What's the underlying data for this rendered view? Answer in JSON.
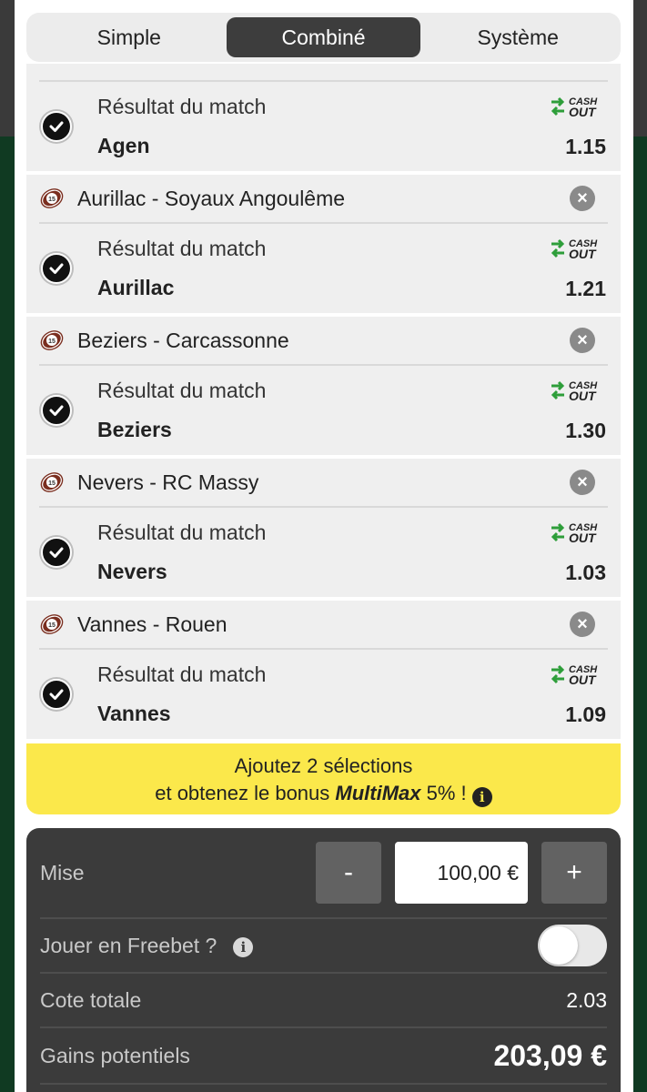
{
  "tabs": [
    {
      "label": "Simple",
      "active": false
    },
    {
      "label": "Combiné",
      "active": true
    },
    {
      "label": "Système",
      "active": false
    }
  ],
  "selections": [
    {
      "match": "",
      "market": "Résultat du match",
      "pick": "Agen",
      "odds": "1.15",
      "cashout": true
    },
    {
      "match": "Aurillac - Soyaux Angoulême",
      "market": "Résultat du match",
      "pick": "Aurillac",
      "odds": "1.21",
      "cashout": true
    },
    {
      "match": "Beziers - Carcassonne",
      "market": "Résultat du match",
      "pick": "Beziers",
      "odds": "1.30",
      "cashout": true
    },
    {
      "match": "Nevers - RC Massy",
      "market": "Résultat du match",
      "pick": "Nevers",
      "odds": "1.03",
      "cashout": true
    },
    {
      "match": "Vannes - Rouen",
      "market": "Résultat du match",
      "pick": "Vannes",
      "odds": "1.09",
      "cashout": true
    }
  ],
  "cashout_text": {
    "top": "CASH",
    "bottom": "OUT"
  },
  "bonus": {
    "line1": "Ajoutez 2 sélections",
    "line2_prefix": "et obtenez le bonus ",
    "name": "MultiMax",
    "line2_suffix": " 5% ! "
  },
  "stake": {
    "label": "Mise",
    "minus": "-",
    "plus": "+",
    "value": "100,00 €"
  },
  "freebet": {
    "label": "Jouer en Freebet ?",
    "enabled": false
  },
  "total_odds": {
    "label": "Cote totale",
    "value": "2.03"
  },
  "potential_gains": {
    "label": "Gains potentiels",
    "value": "203,09 €"
  },
  "colors": {
    "tab_active_bg": "#3d3d3d",
    "bonus_bg": "#fbe84b",
    "panel_bg": "#3b3b3b",
    "cashout_green": "#2e9e3a",
    "page_green": "#103a22"
  }
}
